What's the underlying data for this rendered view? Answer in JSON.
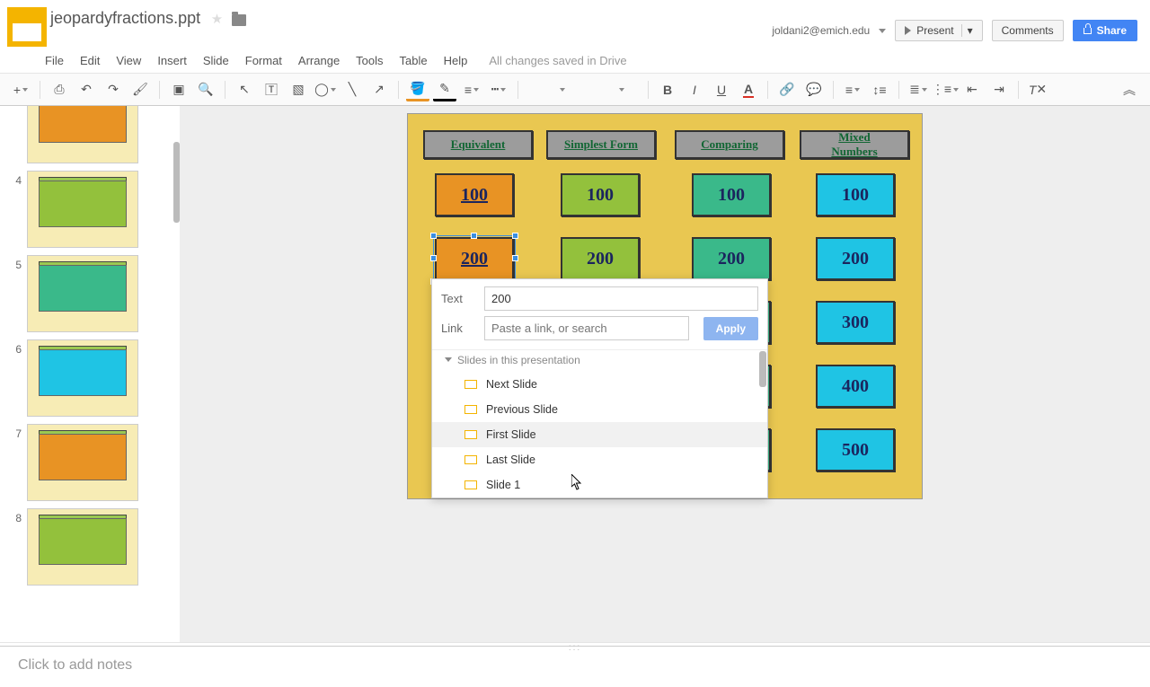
{
  "header": {
    "title": "jeopardyfractions.ppt",
    "user": "joldani2@emich.edu",
    "present": "Present",
    "comments": "Comments",
    "share": "Share"
  },
  "menu": {
    "items": [
      "File",
      "Edit",
      "View",
      "Insert",
      "Slide",
      "Format",
      "Arrange",
      "Tools",
      "Table",
      "Help"
    ],
    "status": "All changes saved in Drive"
  },
  "thumbs": [
    "4",
    "5",
    "6",
    "7",
    "8"
  ],
  "slide": {
    "categories": [
      "Equivalent",
      "Simplest Form",
      "Comparing",
      "Mixed Numbers"
    ],
    "values": [
      "100",
      "200",
      "300",
      "400",
      "500"
    ],
    "col_styles": [
      "c-or",
      "c-gr",
      "c-te",
      "c-cy"
    ]
  },
  "link_popup": {
    "text_label": "Text",
    "text_value": "200",
    "link_label": "Link",
    "link_placeholder": "Paste a link, or search",
    "apply": "Apply",
    "section": "Slides in this presentation",
    "options": [
      "Next Slide",
      "Previous Slide",
      "First Slide",
      "Last Slide",
      "Slide 1"
    ],
    "hover_index": 2
  },
  "notes": {
    "placeholder": "Click to add notes"
  },
  "chart_data": {
    "type": "table",
    "title": "Jeopardy board",
    "series": [
      {
        "name": "Equivalent",
        "values": [
          100,
          200,
          300,
          400,
          500
        ]
      },
      {
        "name": "Simplest Form",
        "values": [
          100,
          200,
          300,
          400,
          500
        ]
      },
      {
        "name": "Comparing",
        "values": [
          100,
          200,
          300,
          400,
          500
        ]
      },
      {
        "name": "Mixed Numbers",
        "values": [
          100,
          200,
          300,
          400,
          500
        ]
      }
    ],
    "categories": [
      "100",
      "200",
      "300",
      "400",
      "500"
    ]
  }
}
